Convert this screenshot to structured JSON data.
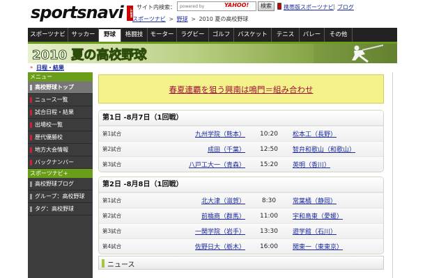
{
  "header": {
    "logo": "sportsnavi",
    "logo_com": ".com",
    "search_label": "サイト内検索：",
    "search_placeholder": "powered by",
    "yahoo_text": "YAHOO!",
    "search_button": "検索",
    "mobile_link": "携帯版スポーツナビ",
    "separator": "|",
    "blog_link": "ブログ"
  },
  "breadcrumb": [
    "スポーツナビ",
    "野球",
    "2010 夏の高校野球"
  ],
  "breadcrumb_sep": ">",
  "nav": [
    {
      "label": "スポーツナビ"
    },
    {
      "label": "サッカー"
    },
    {
      "label": "野球",
      "active": true
    },
    {
      "label": "格闘技"
    },
    {
      "label": "モーター"
    },
    {
      "label": "ラグビー"
    },
    {
      "label": "ゴルフ"
    },
    {
      "label": "バスケット"
    },
    {
      "label": "テニス"
    },
    {
      "label": "バレー"
    },
    {
      "label": "その他"
    }
  ],
  "banner": {
    "title": "2010 夏の高校野球",
    "sub_link": "日程・結果",
    "sub_mark": "»"
  },
  "sidebar": {
    "menu_head": "メニュー",
    "menu_items": [
      "高校野球トップ",
      "ニュース一覧",
      "試合日程・結果",
      "出場校一覧",
      "歴代優勝校",
      "地方大会情報",
      "バックナンバー"
    ],
    "plus_head": "スポーツナビ+",
    "plus_items": [
      "高校野球ブログ",
      "グループ：高校野球",
      "タグ：高校野球"
    ]
  },
  "promo": {
    "link": "春夏連覇を狙う興南は鳴門＝組み合わせ"
  },
  "days": [
    {
      "title": "第1日 -8月7日（1回戦）",
      "games": [
        {
          "no": "第1試合",
          "home": "九州学院（熊本）",
          "time": "10:20",
          "away": "松本工（長野）"
        },
        {
          "no": "第2試合",
          "home": "成田（千葉）",
          "time": "12:50",
          "away": "智弁和歌山（和歌山）"
        },
        {
          "no": "第3試合",
          "home": "八戸工大一（青森）",
          "time": "15:20",
          "away": "英明（香川）"
        }
      ]
    },
    {
      "title": "第2日 -8月8日（1回戦）",
      "games": [
        {
          "no": "第1試合",
          "home": "北大津（滋賀）",
          "time": "8:30",
          "away": "常葉橘（静岡）"
        },
        {
          "no": "第2試合",
          "home": "前橋商（群馬）",
          "time": "11:00",
          "away": "宇和島東（愛媛）"
        },
        {
          "no": "第3試合",
          "home": "一関学院（岩手）",
          "time": "13:30",
          "away": "遊学館（石川）"
        },
        {
          "no": "第4試合",
          "home": "佐野日大（栃木）",
          "time": "16:00",
          "away": "関東一（東東京）"
        }
      ]
    }
  ],
  "news": {
    "title": "ニュース"
  },
  "colors": {
    "nav_bg": "#222222",
    "accent_green": "#6a9e1a",
    "promo_bg": "#f4f28a",
    "promo_link": "#a0103a",
    "link": "#1a2a9a"
  }
}
